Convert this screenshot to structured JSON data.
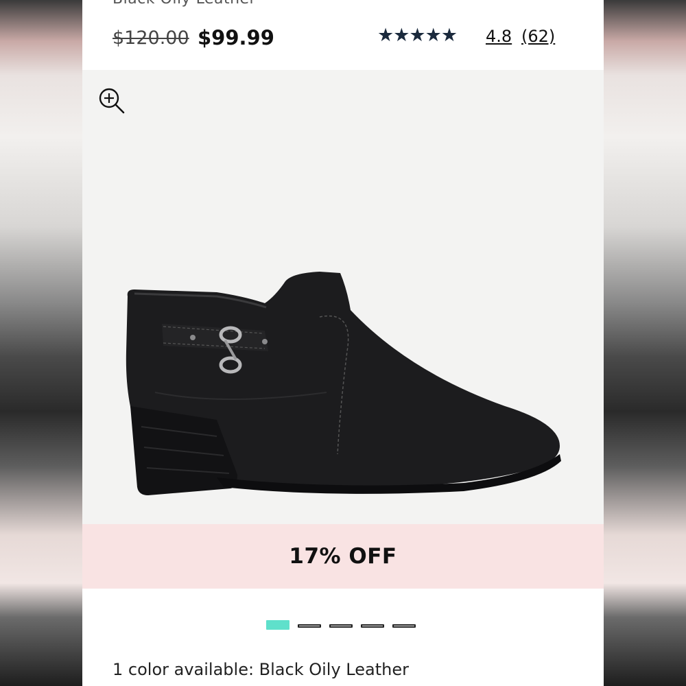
{
  "product": {
    "color_name_partial": "Black Oily Leather",
    "original_price": "$120.00",
    "sale_price": "$99.99",
    "stars": "★★★★★",
    "rating": "4.8",
    "review_count": "(62)",
    "star_color": "#1b2a3d"
  },
  "gallery": {
    "zoom_icon": "zoom-in-icon",
    "image_alt": "black ankle bootie side view",
    "slide_count": 5,
    "active_slide": 1,
    "active_dot_color": "#5fe0cb"
  },
  "promo": {
    "discount_label": "17% OFF",
    "banner_color": "#f9e3e3"
  },
  "colors": {
    "summary": "1 color available: Black Oily Leather"
  }
}
